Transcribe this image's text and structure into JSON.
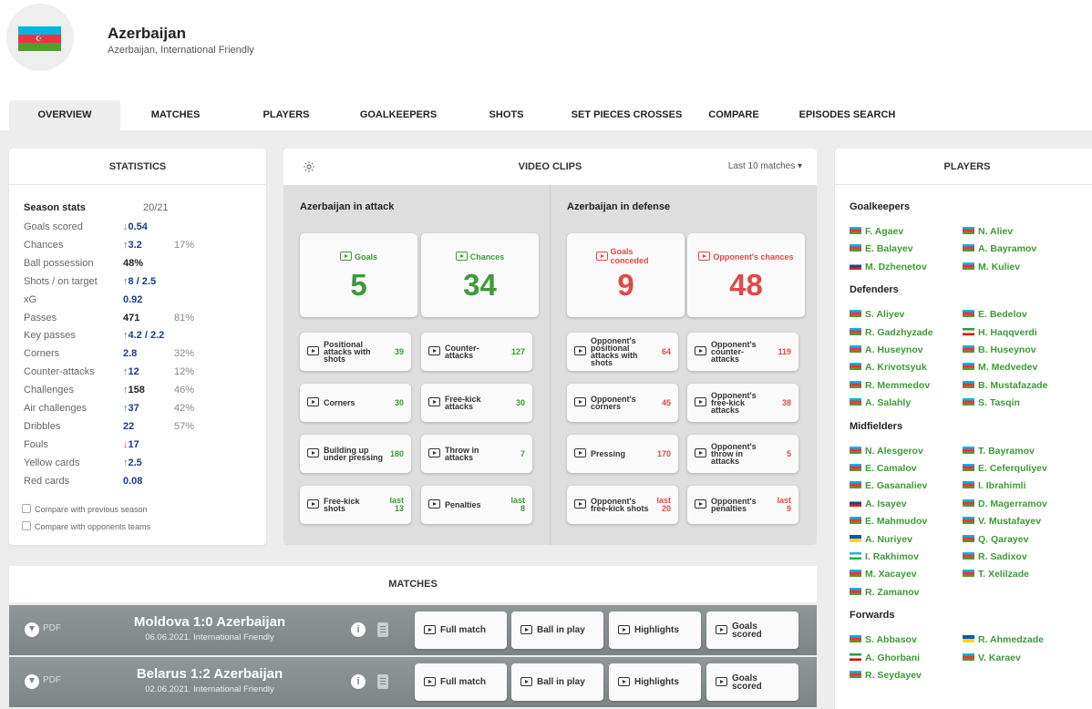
{
  "team": {
    "name": "Azerbaijan",
    "subtitle": "Azerbaijan, International Friendly",
    "flag_colors": [
      "#00b5e2",
      "#ef3340",
      "#509e2f"
    ]
  },
  "tabs": [
    {
      "label": "OVERVIEW",
      "active": true
    },
    {
      "label": "MATCHES"
    },
    {
      "label": "PLAYERS"
    },
    {
      "label": "GOALKEEPERS"
    },
    {
      "label": "SHOTS"
    },
    {
      "label": "SET PIECES CROSSES"
    },
    {
      "label": "COMPARE"
    },
    {
      "label": "EPISODES SEARCH"
    }
  ],
  "statistics": {
    "title": "STATISTICS",
    "header_label": "Season stats",
    "season": "20/21",
    "rows": [
      {
        "label": "Goals scored",
        "arrow": "↓",
        "dir": "down",
        "value": "0.54",
        "pct": ""
      },
      {
        "label": "Chances",
        "arrow": "↑",
        "dir": "up",
        "value": "3.2",
        "pct": "17%"
      },
      {
        "label": "Ball possession",
        "arrow": "",
        "dir": "",
        "value": "48%",
        "pct": "",
        "black": true
      },
      {
        "label": "Shots / on target",
        "arrow": "↑",
        "dir": "up",
        "value": "8 / 2.5",
        "pct": ""
      },
      {
        "label": "xG",
        "arrow": "",
        "dir": "",
        "value": "0.92",
        "pct": ""
      },
      {
        "label": "Passes",
        "arrow": "",
        "dir": "",
        "value": "471",
        "pct": "81%",
        "black": true
      },
      {
        "label": "Key passes",
        "arrow": "↑",
        "dir": "up",
        "value": "4.2 / 2.2",
        "pct": ""
      },
      {
        "label": "Corners",
        "arrow": "",
        "dir": "",
        "value": "2.8",
        "pct": "32%"
      },
      {
        "label": "Counter-attacks",
        "arrow": "↑",
        "dir": "up",
        "value": "12",
        "pct": "12%"
      },
      {
        "label": "Challenges",
        "arrow": "↑",
        "dir": "up",
        "value": "158",
        "pct": "46%",
        "black": true
      },
      {
        "label": "Air challenges",
        "arrow": "↑",
        "dir": "up",
        "value": "37",
        "pct": "42%"
      },
      {
        "label": "Dribbles",
        "arrow": "",
        "dir": "",
        "value": "22",
        "pct": "57%"
      },
      {
        "label": "Fouls",
        "arrow": "↓",
        "dir": "down",
        "value": "17",
        "pct": ""
      },
      {
        "label": "Yellow cards",
        "arrow": "↑",
        "dir": "up",
        "value": "2.5",
        "pct": ""
      },
      {
        "label": "Red cards",
        "arrow": "",
        "dir": "",
        "value": "0.08",
        "pct": ""
      }
    ],
    "checkboxes": [
      "Compare with previous season",
      "Compare with opponents teams"
    ]
  },
  "video_clips": {
    "title": "VIDEO CLIPS",
    "filter": "Last 10 matches ▾",
    "attack": {
      "title": "Azerbaijan in attack",
      "big": [
        {
          "label": "Goals",
          "value": "5"
        },
        {
          "label": "Chances",
          "value": "34"
        }
      ],
      "small": [
        {
          "label": "Positional attacks with shots",
          "value": "39"
        },
        {
          "label": "Counter-attacks",
          "value": "127"
        },
        {
          "label": "Corners",
          "value": "30"
        },
        {
          "label": "Free-kick attacks",
          "value": "30"
        },
        {
          "label": "Building up under pressing",
          "value": "180"
        },
        {
          "label": "Throw in attacks",
          "value": "7"
        },
        {
          "label": "Free-kick shots",
          "value": "last 13"
        },
        {
          "label": "Penalties",
          "value": "last 8"
        }
      ]
    },
    "defense": {
      "title": "Azerbaijan in defense",
      "big": [
        {
          "label": "Goals conceded",
          "value": "9"
        },
        {
          "label": "Opponent's chances",
          "value": "48"
        }
      ],
      "small": [
        {
          "label": "Opponent's positional attacks with shots",
          "value": "64"
        },
        {
          "label": "Opponent's counter-attacks",
          "value": "119"
        },
        {
          "label": "Opponent's corners",
          "value": "45"
        },
        {
          "label": "Opponent's free-kick attacks",
          "value": "38"
        },
        {
          "label": "Pressing",
          "value": "170"
        },
        {
          "label": "Opponent's throw in attacks",
          "value": "5"
        },
        {
          "label": "Opponent's free-kick shots",
          "value": "last 20"
        },
        {
          "label": "Opponent's penalties",
          "value": "last 9"
        }
      ]
    }
  },
  "players": {
    "title": "PLAYERS",
    "groups": [
      {
        "name": "Goalkeepers",
        "players": [
          {
            "name": "F. Agaev",
            "flag": "az"
          },
          {
            "name": "N. Aliev",
            "flag": "az"
          },
          {
            "name": "E. Balayev",
            "flag": "az"
          },
          {
            "name": "A. Bayramov",
            "flag": "az"
          },
          {
            "name": "M. Dzhenetov",
            "flag": "ru"
          },
          {
            "name": "M. Kuliev",
            "flag": "az"
          }
        ]
      },
      {
        "name": "Defenders",
        "players": [
          {
            "name": "S. Aliyev",
            "flag": "az"
          },
          {
            "name": "E. Bedelov",
            "flag": "az"
          },
          {
            "name": "R. Gadzhyzade",
            "flag": "az"
          },
          {
            "name": "H. Haqqverdi",
            "flag": "ir"
          },
          {
            "name": "A. Huseynov",
            "flag": "az"
          },
          {
            "name": "B. Huseynov",
            "flag": "az"
          },
          {
            "name": "A. Krivotsyuk",
            "flag": "az"
          },
          {
            "name": "M. Medvedev",
            "flag": "az"
          },
          {
            "name": "R. Memmedov",
            "flag": "az"
          },
          {
            "name": "B. Mustafazade",
            "flag": "az"
          },
          {
            "name": "A. Salahly",
            "flag": "az"
          },
          {
            "name": "S. Tasqin",
            "flag": "az"
          }
        ]
      },
      {
        "name": "Midfielders",
        "players": [
          {
            "name": "N. Alesgerov",
            "flag": "az"
          },
          {
            "name": "T. Bayramov",
            "flag": "az"
          },
          {
            "name": "E. Camalov",
            "flag": "az"
          },
          {
            "name": "E. Ceferquliyev",
            "flag": "az"
          },
          {
            "name": "E. Gasanaliev",
            "flag": "az"
          },
          {
            "name": "I. Ibrahimli",
            "flag": "az"
          },
          {
            "name": "A. Isayev",
            "flag": "ru"
          },
          {
            "name": "D. Magerramov",
            "flag": "az"
          },
          {
            "name": "E. Mahmudov",
            "flag": "az"
          },
          {
            "name": "V. Mustafayev",
            "flag": "az"
          },
          {
            "name": "A. Nuriyev",
            "flag": "ua"
          },
          {
            "name": "Q. Qarayev",
            "flag": "az"
          },
          {
            "name": "I. Rakhimov",
            "flag": "uz"
          },
          {
            "name": "R. Sadixov",
            "flag": "az"
          },
          {
            "name": "M. Xacayev",
            "flag": "az"
          },
          {
            "name": "T. Xelilzade",
            "flag": "az"
          },
          {
            "name": "R. Zamanov",
            "flag": "az"
          }
        ]
      },
      {
        "name": "Forwards",
        "players": [
          {
            "name": "S. Abbasov",
            "flag": "az"
          },
          {
            "name": "R. Ahmedzade",
            "flag": "ua"
          },
          {
            "name": "A. Ghorbani",
            "flag": "ir"
          },
          {
            "name": "V. Karaev",
            "flag": "az"
          },
          {
            "name": "R. Seydayev",
            "flag": "az"
          }
        ]
      }
    ]
  },
  "matches": {
    "title": "MATCHES",
    "pdf_label": "PDF",
    "info_glyph": "i",
    "buttons": [
      "Full match",
      "Ball in play",
      "Highlights",
      "Goals scored"
    ],
    "items": [
      {
        "title": "Moldova 1:0 Azerbaijan",
        "subtitle": "06.06.2021. International Friendly"
      },
      {
        "title": "Belarus 1:2 Azerbaijan",
        "subtitle": "02.06.2021. International Friendly"
      }
    ]
  }
}
